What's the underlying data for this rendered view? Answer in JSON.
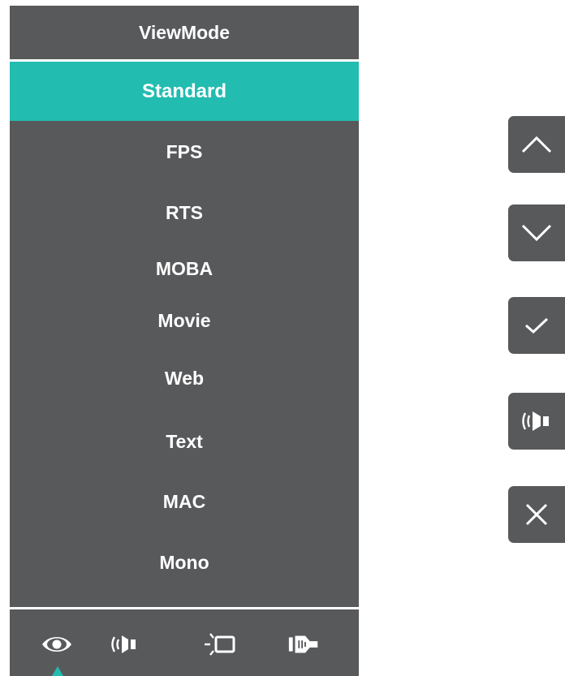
{
  "menu": {
    "title": "ViewMode",
    "items": [
      {
        "label": "Standard",
        "selected": true
      },
      {
        "label": "FPS",
        "selected": false
      },
      {
        "label": "RTS",
        "selected": false
      },
      {
        "label": "MOBA",
        "selected": false
      },
      {
        "label": "Movie",
        "selected": false
      },
      {
        "label": "Web",
        "selected": false
      },
      {
        "label": "Text",
        "selected": false
      },
      {
        "label": "MAC",
        "selected": false
      },
      {
        "label": "Mono",
        "selected": false
      }
    ],
    "bottom_icons": [
      "eye-icon",
      "audio-speaker-icon",
      "display-brightness-icon",
      "input-source-icon"
    ],
    "active_icon": "eye-icon"
  },
  "keys": [
    "chevron-up-icon",
    "chevron-down-icon",
    "checkmark-icon",
    "audio-speaker-icon",
    "close-icon"
  ],
  "colors": {
    "panel": "#58595b",
    "accent": "#22bcb0",
    "text": "#ffffff",
    "background": "#ffffff"
  }
}
